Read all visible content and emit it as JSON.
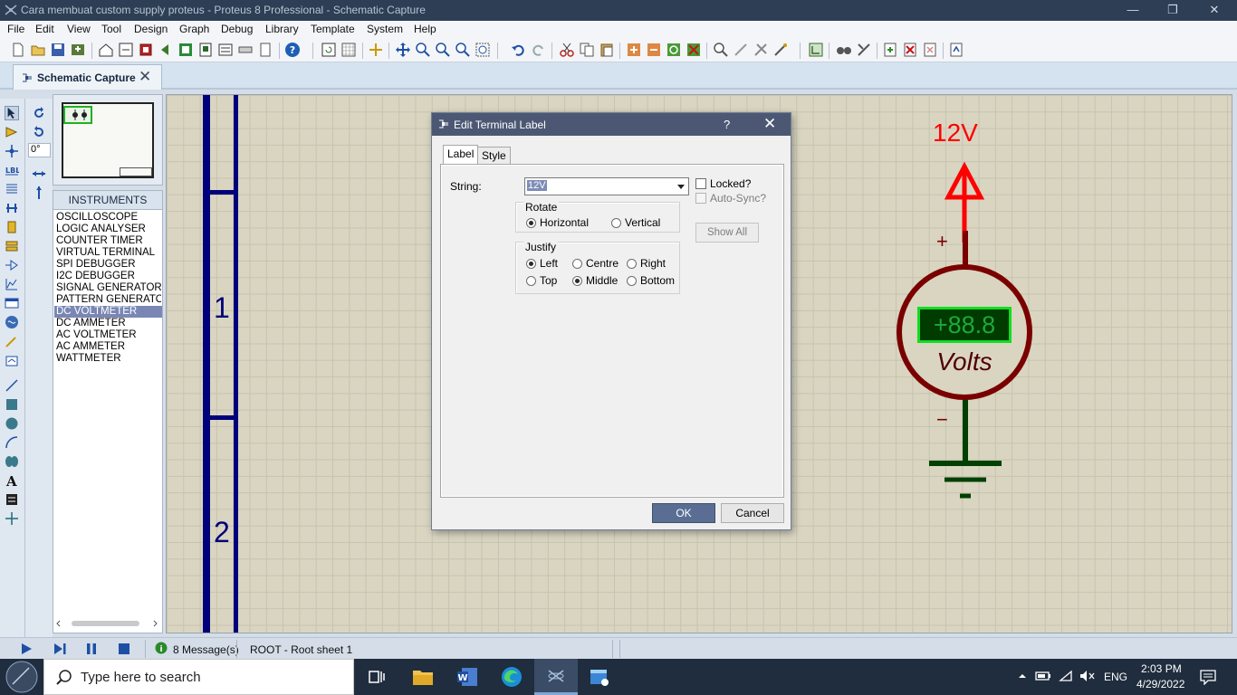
{
  "window": {
    "title": "Cara membuat custom supply proteus - Proteus 8 Professional - Schematic Capture",
    "minimize": "—",
    "maximize": "❐",
    "close": "✕"
  },
  "menu": [
    "File",
    "Edit",
    "View",
    "Tool",
    "Design",
    "Graph",
    "Debug",
    "Library",
    "Template",
    "System",
    "Help"
  ],
  "tab": {
    "label": "Schematic Capture",
    "close": "✕"
  },
  "toolbox": {
    "angle": "0°"
  },
  "instruments": {
    "header": "INSTRUMENTS",
    "items": [
      "OSCILLOSCOPE",
      "LOGIC ANALYSER",
      "COUNTER TIMER",
      "VIRTUAL TERMINAL",
      "SPI DEBUGGER",
      "I2C DEBUGGER",
      "SIGNAL GENERATOR",
      "PATTERN GENERATO",
      "DC VOLTMETER",
      "DC AMMETER",
      "AC VOLTMETER",
      "AC AMMETER",
      "WATTMETER"
    ],
    "selected": "DC VOLTMETER"
  },
  "schematic": {
    "row1": "1",
    "row2": "2",
    "terminal_label": "12V",
    "plus": "+",
    "minus": "−",
    "meter_display": "+88.8",
    "meter_unit": "Volts",
    "colors": {
      "wire": "#004000",
      "terminal": "#ff0000",
      "meter_ring": "#7a0000",
      "border": "#00007a"
    }
  },
  "dialog": {
    "title": "Edit Terminal Label",
    "help": "?",
    "close": "✕",
    "tabs": [
      "Label",
      "Style"
    ],
    "string_label": "String:",
    "string_value": "12V",
    "rotate": {
      "title": "Rotate",
      "options": [
        "Horizontal",
        "Vertical"
      ],
      "selected": "Horizontal"
    },
    "justify": {
      "title": "Justify",
      "options": [
        "Left",
        "Centre",
        "Right",
        "Top",
        "Middle",
        "Bottom"
      ],
      "selected": [
        "Left",
        "Middle"
      ]
    },
    "locked": "Locked?",
    "autosync": "Auto-Sync?",
    "show_all": "Show All",
    "ok": "OK",
    "cancel": "Cancel"
  },
  "status": {
    "messages": "8 Message(s)",
    "sheet": "ROOT - Root sheet 1"
  },
  "taskbar": {
    "search_placeholder": "Type here to search",
    "lang": "ENG",
    "time": "2:03 PM",
    "date": "4/29/2022"
  }
}
